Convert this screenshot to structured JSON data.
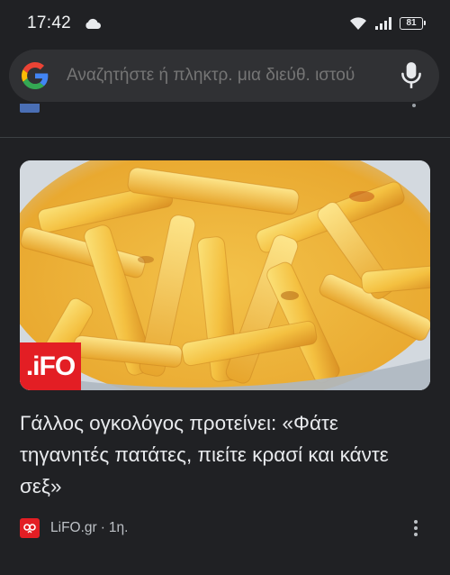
{
  "status_bar": {
    "time": "17:42",
    "battery": "81",
    "icons": [
      "cloud-icon",
      "wifi-icon",
      "signal-icon",
      "battery-icon"
    ]
  },
  "search": {
    "placeholder": "Αναζητήστε ή πληκτρ. μια διεύθ. ιστού"
  },
  "article": {
    "source_logo_text": ".iFO",
    "title": "Γάλλος ογκολόγος προτείνει: «Φάτε τηγανητές πατάτες, πιείτε κρασί και κάντε σεξ»",
    "source": "LiFO.gr",
    "separator": "·",
    "time": "1η."
  },
  "colors": {
    "background": "#202124",
    "search_bar": "#303134",
    "text_primary": "#e8eaed",
    "text_secondary": "#bdc1c6",
    "brand_red": "#e31e24"
  }
}
